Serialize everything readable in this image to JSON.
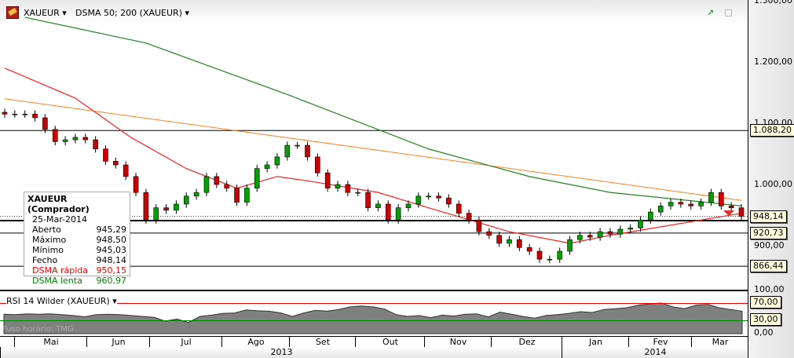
{
  "header": {
    "symbol": "XAUEUR",
    "indicator": "DSMA 50; 200 (XAUEUR)",
    "icons": [
      "gold-bar-icon",
      "trend-icon",
      "restore-icon"
    ]
  },
  "price_axis": {
    "ticks": [
      "1.300,00",
      "1.200,00",
      "1.100,00",
      "1.000,00",
      "900,00"
    ],
    "tags": {
      "resistance": "1.088,20",
      "last": "948,14",
      "support1": "920,73",
      "support2": "866,44"
    }
  },
  "info_box": {
    "title": "XAUEUR (Comprador)",
    "date": "25-Mar-2014",
    "rows": [
      {
        "label": "Aberto",
        "value": "945,29",
        "color": "#000000"
      },
      {
        "label": "Máximo",
        "value": "948,50",
        "color": "#000000"
      },
      {
        "label": "Mínimo",
        "value": "945,03",
        "color": "#000000"
      },
      {
        "label": "Fecho",
        "value": "948,14",
        "color": "#000000"
      },
      {
        "label": "DSMA rápida",
        "value": "950,15",
        "color": "#ff0000"
      },
      {
        "label": "DSMA lenta",
        "value": "960,97",
        "color": "#008000"
      }
    ]
  },
  "rsi": {
    "title": "RSI 14 Wilder (XAUEUR)",
    "ticks": [
      "100,00",
      "0,00"
    ],
    "tags": [
      "70,00",
      "30,00"
    ],
    "watermark": "Fuso horário: TMG",
    "values": [
      45,
      44,
      46,
      45,
      46,
      44,
      42,
      39,
      44,
      45,
      44,
      42,
      40,
      38,
      29,
      34,
      26,
      40,
      43,
      47,
      48,
      55,
      53,
      52,
      48,
      40,
      48,
      54,
      52,
      56,
      62,
      64,
      62,
      57,
      44,
      40,
      42,
      37,
      43,
      41,
      45,
      46,
      39,
      50,
      45,
      40,
      36,
      42,
      44,
      47,
      51,
      49,
      56,
      58,
      60,
      66,
      69,
      71,
      62,
      58,
      66,
      68,
      60,
      56,
      52
    ]
  },
  "time_axis": {
    "months": [
      "Mai",
      "Jun",
      "Jul",
      "Ago",
      "Set",
      "Out",
      "Nov",
      "Dez",
      "Jan",
      "Fev",
      "Mar"
    ],
    "years": [
      "2013",
      "2014"
    ]
  },
  "chart_data": {
    "type": "candlestick",
    "closes": [
      1115,
      1115,
      1115,
      1109,
      1090,
      1070,
      1073,
      1077,
      1073,
      1058,
      1038,
      1032,
      1013,
      987,
      942,
      962,
      958,
      968,
      981,
      987,
      1013,
      1000,
      994,
      971,
      994,
      1026,
      1032,
      1045,
      1064,
      1064,
      1045,
      1019,
      994,
      1000,
      987,
      987,
      962,
      968,
      942,
      962,
      968,
      981,
      981,
      978,
      968,
      953,
      942,
      923,
      917,
      904,
      910,
      897,
      891,
      878,
      878,
      891,
      910,
      917,
      914,
      923,
      919,
      927,
      929,
      942,
      955,
      965,
      971,
      968,
      965,
      971,
      987,
      965,
      962,
      948
    ],
    "sma_fast": [
      [
        0,
        1190
      ],
      [
        7,
        1141
      ],
      [
        12.5,
        1077
      ],
      [
        18,
        1026
      ],
      [
        23,
        994
      ],
      [
        27,
        1013
      ],
      [
        30,
        1006
      ],
      [
        37,
        987
      ],
      [
        42,
        962
      ],
      [
        50,
        923
      ],
      [
        56,
        904
      ],
      [
        60,
        917
      ],
      [
        73,
        953
      ]
    ],
    "sma_slow": [
      [
        2,
        1273
      ],
      [
        14,
        1231
      ],
      [
        28,
        1147
      ],
      [
        42,
        1058
      ],
      [
        52,
        1013
      ],
      [
        60,
        987
      ],
      [
        73,
        965
      ]
    ],
    "trendline": [
      [
        0,
        1140
      ],
      [
        73,
        974
      ]
    ],
    "levels": [
      1088.2,
      948.14,
      941,
      920.73,
      866.44
    ],
    "colors": {
      "up": "#00a000",
      "down": "#cc0000",
      "fast": "#ff2020",
      "slow": "#208020",
      "trend": "#ff8020"
    }
  }
}
